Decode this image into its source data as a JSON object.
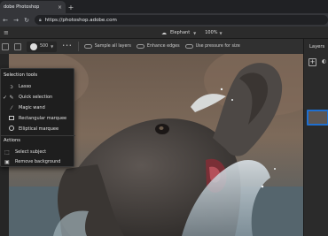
{
  "browser": {
    "tab_title": "dobe Photoshop",
    "tab_close_icon": "close-icon",
    "new_tab_icon": "plus-icon",
    "url": "https://photoshop.adobe.com"
  },
  "app": {
    "doc_name": "Elephant",
    "zoom": "100%"
  },
  "options": {
    "brush_size": "500",
    "sample_all_layers": "Sample all layers",
    "enhance_edges": "Enhance edges",
    "use_pressure": "Use pressure for size"
  },
  "layers_panel": {
    "title": "Layers"
  },
  "flyout": {
    "selection_header": "Selection tools",
    "items": [
      {
        "label": "Lasso",
        "icon": "lasso-icon"
      },
      {
        "label": "Quick selection",
        "icon": "quick-selection-icon",
        "selected": true
      },
      {
        "label": "Magic wand",
        "icon": "magic-wand-icon"
      },
      {
        "label": "Rectangular marquee",
        "icon": "rect-marquee-icon"
      },
      {
        "label": "Elliptical marquee",
        "icon": "ellipse-marquee-icon"
      }
    ],
    "actions_header": "Actions",
    "actions": [
      {
        "label": "Select subject",
        "icon": "select-subject-icon"
      },
      {
        "label": "Remove background",
        "icon": "remove-background-icon"
      }
    ]
  },
  "colors": {
    "accent": "#1f6fd0",
    "panel_bg": "#1e1e1e"
  }
}
